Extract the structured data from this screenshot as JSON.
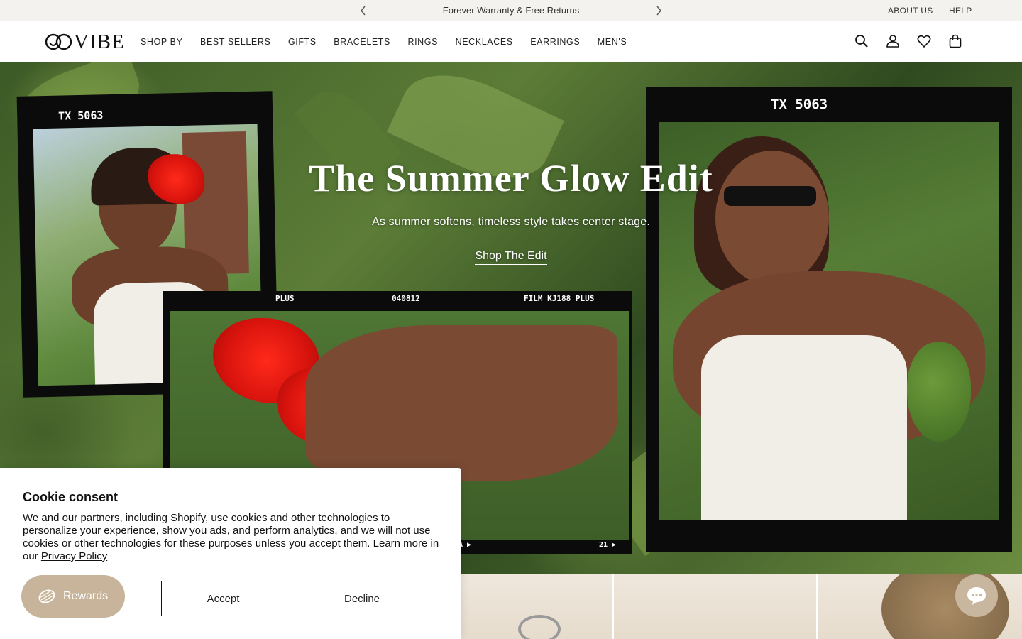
{
  "announcement": {
    "message": "Forever Warranty & Free Returns",
    "about_label": "ABOUT US",
    "help_label": "HELP"
  },
  "header": {
    "logo_text": "VIBE",
    "nav": [
      "SHOP BY",
      "BEST SELLERS",
      "GIFTS",
      "BRACELETS",
      "RINGS",
      "NECKLACES",
      "EARRINGS",
      "MEN'S"
    ],
    "icons": [
      "search-icon",
      "account-icon",
      "wishlist-icon",
      "cart-icon"
    ]
  },
  "hero": {
    "title": "The Summer Glow Edit",
    "subtitle": "As summer softens, timeless style takes center stage.",
    "cta": "Shop The Edit",
    "film_left": "TX 5063",
    "film_right": "TX 5063",
    "film_bottom": [
      "PLUS",
      "040812",
      "FILM KJ188 PLUS"
    ],
    "film_bottom_marks": [
      "1A ▶",
      "21 ▶"
    ]
  },
  "cookie": {
    "title": "Cookie consent",
    "body": "We and our partners, including Shopify, use cookies and other technologies to personalize your experience, show you ads, and perform analytics, and we will not use cookies or other technologies for these purposes unless you accept them. Learn more in our ",
    "policy_link": "Privacy Policy",
    "accept_label": "Accept",
    "decline_label": "Decline"
  },
  "rewards": {
    "label": "Rewards"
  },
  "colors": {
    "announce_bg": "#f4f2ee",
    "rewards_bg": "#c7b49a",
    "chat_bg": "#c9b69e"
  }
}
